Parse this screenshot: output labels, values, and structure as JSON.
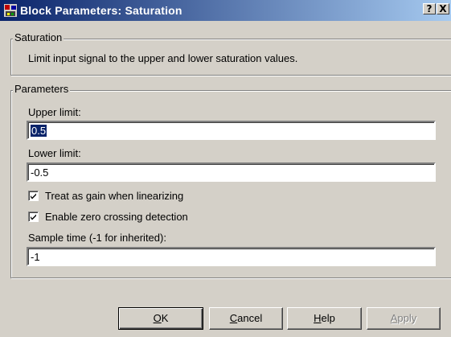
{
  "window": {
    "title": "Block Parameters: Saturation",
    "help_glyph": "?",
    "close_glyph": "X"
  },
  "saturation_group": {
    "label": "Saturation",
    "description": "Limit input signal to the upper and lower saturation values."
  },
  "parameters_group": {
    "label": "Parameters",
    "upper_limit": {
      "label": "Upper limit:",
      "value": "0.5",
      "selected": true
    },
    "lower_limit": {
      "label": "Lower limit:",
      "value": "-0.5"
    },
    "treat_as_gain": {
      "label": "Treat as gain when linearizing",
      "checked": true
    },
    "zero_crossing": {
      "label": "Enable zero crossing detection",
      "checked": true
    },
    "sample_time": {
      "label": "Sample time (-1 for inherited):",
      "value": "-1"
    }
  },
  "buttons": {
    "ok": {
      "mnemonic": "O",
      "rest": "K"
    },
    "cancel": {
      "mnemonic": "C",
      "rest": "ancel"
    },
    "help": {
      "mnemonic": "H",
      "rest": "elp"
    },
    "apply": {
      "mnemonic": "A",
      "rest": "pply",
      "enabled": false
    }
  },
  "colors": {
    "titlebar_start": "#0a246a",
    "titlebar_end": "#a6caf0",
    "face": "#d4d0c8",
    "selection": "#0a246a"
  },
  "icons": {
    "app": "simulink-block-icon",
    "check": "checkmark-icon"
  }
}
